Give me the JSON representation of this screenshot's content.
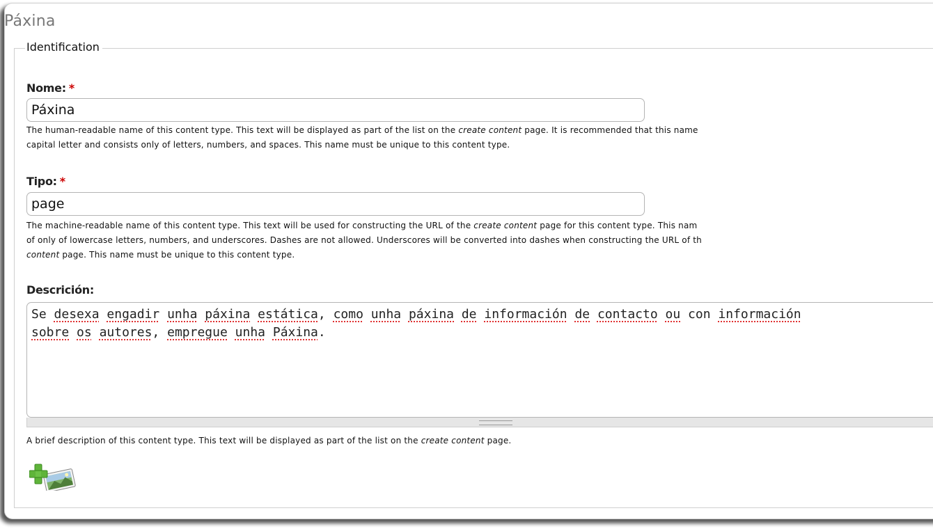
{
  "page": {
    "title": "Páxina"
  },
  "fieldset": {
    "legend": "Identification"
  },
  "name_field": {
    "label": "Nome:",
    "required_mark": "*",
    "value": "Páxina",
    "help_before": "The human-readable name of this content type. This text will be displayed as part of the list on the ",
    "help_em": "create content",
    "help_after": " page. It is recommended that this name",
    "help_line2": "capital letter and consists only of letters, numbers, and spaces. This name must be unique to this content type."
  },
  "type_field": {
    "label": "Tipo:",
    "required_mark": "*",
    "value": "page",
    "help1_before": "The machine-readable name of this content type. This text will be used for constructing the URL of the ",
    "help1_em": "create content",
    "help1_after": " page for this content type. This nam",
    "help_line2": "of only of lowercase letters, numbers, and underscores. Dashes are not allowed. Underscores will be converted into dashes when constructing the URL of th",
    "help3_em": "content",
    "help3_after": " page. This name must be unique to this content type."
  },
  "description_field": {
    "label": "Descrición:",
    "line1": [
      {
        "t": "Se ",
        "s": false
      },
      {
        "t": "desexa",
        "s": true
      },
      {
        "t": " ",
        "s": false
      },
      {
        "t": "engadir",
        "s": true
      },
      {
        "t": " ",
        "s": false
      },
      {
        "t": "unha",
        "s": true
      },
      {
        "t": " ",
        "s": false
      },
      {
        "t": "páxina",
        "s": true
      },
      {
        "t": " ",
        "s": false
      },
      {
        "t": "estática",
        "s": true
      },
      {
        "t": ", ",
        "s": false
      },
      {
        "t": "como",
        "s": true
      },
      {
        "t": " ",
        "s": false
      },
      {
        "t": "unha",
        "s": true
      },
      {
        "t": " ",
        "s": false
      },
      {
        "t": "páxina",
        "s": true
      },
      {
        "t": " ",
        "s": false
      },
      {
        "t": "de",
        "s": true
      },
      {
        "t": " ",
        "s": false
      },
      {
        "t": "información",
        "s": true
      },
      {
        "t": " ",
        "s": false
      },
      {
        "t": "de",
        "s": true
      },
      {
        "t": " ",
        "s": false
      },
      {
        "t": "contacto",
        "s": true
      },
      {
        "t": " ",
        "s": false
      },
      {
        "t": "ou",
        "s": true
      },
      {
        "t": " con ",
        "s": false
      },
      {
        "t": "información",
        "s": true
      }
    ],
    "line2": [
      {
        "t": "sobre",
        "s": true
      },
      {
        "t": " ",
        "s": false
      },
      {
        "t": "os",
        "s": true
      },
      {
        "t": " ",
        "s": false
      },
      {
        "t": "autores",
        "s": true
      },
      {
        "t": ", ",
        "s": false
      },
      {
        "t": "empregue",
        "s": true
      },
      {
        "t": " ",
        "s": false
      },
      {
        "t": "unha",
        "s": true
      },
      {
        "t": " ",
        "s": false
      },
      {
        "t": "Páxina",
        "s": true
      },
      {
        "t": ".",
        "s": false
      }
    ],
    "help_before": "A brief description of this content type. This text will be displayed as part of the list on the ",
    "help_em": "create content",
    "help_after": " page."
  },
  "icons": {
    "add_image": "add-image-icon"
  }
}
